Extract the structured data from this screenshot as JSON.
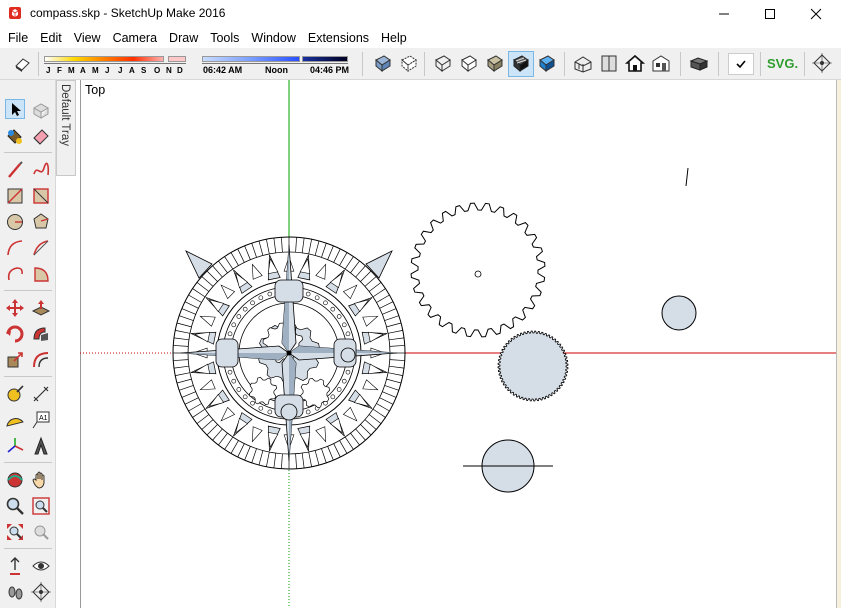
{
  "window": {
    "title": "compass.skp - SketchUp Make 2016",
    "minimize_icon": "minimize-icon",
    "maximize_icon": "maximize-icon",
    "close_icon": "close-icon"
  },
  "menu": [
    "File",
    "Edit",
    "View",
    "Camera",
    "Draw",
    "Tools",
    "Window",
    "Extensions",
    "Help"
  ],
  "shadows": {
    "months": [
      "J",
      "F",
      "M",
      "A",
      "M",
      "J",
      "J",
      "A",
      "S",
      "O",
      "N",
      "D"
    ],
    "time_start": "06:42 AM",
    "time_mid": "Noon",
    "time_end": "04:46 PM"
  },
  "toolbar": {
    "svg_label": "SVG."
  },
  "tray": {
    "label": "Default Tray"
  },
  "viewport": {
    "view_name": "Top"
  },
  "colors": {
    "red_axis": "#cc0000",
    "green_axis": "#00a000",
    "face_fill": "#d5dde6",
    "svg_green": "#2e9d2e"
  }
}
